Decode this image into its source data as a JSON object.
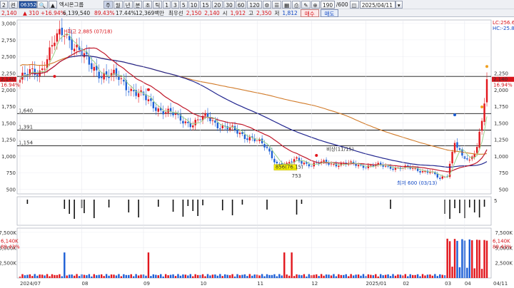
{
  "toolbar": {
    "row1": {
      "menu": "2",
      "mode": "켠",
      "code": "063520",
      "name": "엑시온그룹",
      "tabs": [
        "주",
        "월",
        "년",
        "분",
        "초",
        "틱"
      ],
      "intervals": [
        "1",
        "3",
        "5",
        "10",
        "15",
        "20",
        "30",
        "60",
        "120"
      ],
      "count": "190",
      "total": "/600",
      "date": "2025/04/11"
    },
    "row2": {
      "price": "2,140",
      "change": "▲ 310 +16.94%",
      "volume": "6,139,540",
      "ratio": "89.43%",
      "turnover": "17.44%",
      "amount": "12,369백만",
      "bid_label": "최우선",
      "bid1": "2,150",
      "bid2": "2,140",
      "open_label": "시",
      "open": "1,912",
      "high_label": "고",
      "high": "2,350",
      "low_label": "저",
      "low": "1,812",
      "sell_btn": "매수",
      "buy_btn": "매도"
    }
  },
  "price_axis": [
    "3,000",
    "2,750",
    "2,500",
    "2,250",
    "2,000",
    "1,750",
    "1,500",
    "1,250",
    "1,000",
    "750",
    "500"
  ],
  "price_axis_right": [
    "2,250",
    "2,000",
    "1,750",
    "1,500",
    "1,250",
    "1,000",
    "750",
    "500"
  ],
  "right_labels": {
    "lc": "LC:256.67",
    "hc": "HC:-25.82",
    "price": "2,140",
    "pct": "16.94%"
  },
  "left_labels": {
    "price": "2,140",
    "pct": "16.94%"
  },
  "hlines": [
    {
      "label": "",
      "value": 2200
    },
    {
      "label": "1,640",
      "value": 1640
    },
    {
      "label": "1,391",
      "value": 1391
    },
    {
      "label": "1,154",
      "value": 1154
    }
  ],
  "annotations": {
    "high": "최고 2,885 (07/18)",
    "low": "최저 600 (03/13)",
    "mid_box": "856(76.15)",
    "mid_below": "753",
    "mid_top": "비상(11/15)"
  },
  "volume_axis": [
    "7,500K",
    "5,000K",
    "2,500K"
  ],
  "volume_right": [
    "7,500K",
    "5,000K",
    "2,500K"
  ],
  "volume_labels": {
    "left": "6,140K",
    "left_pct": "89.43%",
    "right": "6,140K",
    "right_pct": "89.43%"
  },
  "signal_axis": "5",
  "date_axis": [
    "2024/07",
    "08",
    "09",
    "10",
    "11",
    "12",
    "2025/01",
    "02",
    "03",
    "04",
    "04/11"
  ],
  "colors": {
    "up": "#e2161d",
    "down": "#1d5fd6",
    "ma5": "#9ad18a",
    "ma20": "#c0182a",
    "ma60": "#22268f",
    "ma120": "#d17a28"
  }
}
